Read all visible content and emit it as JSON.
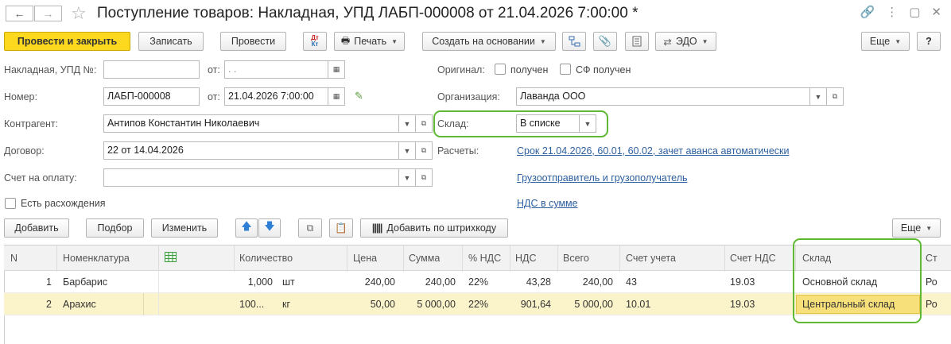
{
  "window": {
    "title": "Поступление товаров: Накладная, УПД ЛАБП-000008 от 21.04.2026 7:00:00 *"
  },
  "toolbar": {
    "post_close": "Провести и закрыть",
    "save": "Записать",
    "post": "Провести",
    "dt_kt_top": "Дт",
    "dt_kt_bottom": "Кт",
    "print": "Печать",
    "create_based": "Создать на основании",
    "edo": "ЭДО",
    "more": "Еще",
    "help": "?"
  },
  "form": {
    "invoice_label": "Накладная, УПД №:",
    "invoice_value": "",
    "from1_label": "от:",
    "from1_value": ".  .",
    "number_label": "Номер:",
    "number_value": "ЛАБП-000008",
    "from2_label": "от:",
    "from2_value": "21.04.2026  7:00:00",
    "counterparty_label": "Контрагент:",
    "counterparty_value": "Антипов Константин Николаевич",
    "contract_label": "Договор:",
    "contract_value": "22 от 14.04.2026",
    "payment_account_label": "Счет на оплату:",
    "payment_account_value": "",
    "discrepancies_label": "Есть расхождения",
    "original_label": "Оригинал:",
    "received_label": "получен",
    "sf_received_label": "СФ получен",
    "organization_label": "Организация:",
    "organization_value": "Лаванда ООО",
    "warehouse_label": "Склад:",
    "warehouse_value": "В списке",
    "settlements_label": "Расчеты:",
    "settlements_link": "Срок 21.04.2026, 60.01, 60.02, зачет аванса автоматически",
    "shipper_link": "Грузоотправитель и грузополучатель",
    "vat_link": "НДС в сумме"
  },
  "table_toolbar": {
    "add": "Добавить",
    "selection": "Подбор",
    "change": "Изменить",
    "barcode": "Добавить по штрихкоду",
    "more": "Еще"
  },
  "table": {
    "headers": {
      "n": "N",
      "item": "Номенклатура",
      "qty": "Количество",
      "price": "Цена",
      "sum": "Сумма",
      "vat_rate": "% НДС",
      "vat": "НДС",
      "total": "Всего",
      "account": "Счет учета",
      "vat_account": "Счет НДС",
      "warehouse": "Склад",
      "next": "Ст"
    },
    "rows": [
      {
        "n": "1",
        "item": "Барбарис",
        "qty": "1,000",
        "unit": "шт",
        "price": "240,00",
        "sum": "240,00",
        "vat_rate": "22%",
        "vat": "43,28",
        "total": "240,00",
        "account": "43",
        "vat_account": "19.03",
        "warehouse": "Основной склад",
        "next": "Ро"
      },
      {
        "n": "2",
        "item": "Арахис",
        "qty": "100...",
        "unit": "кг",
        "price": "50,00",
        "sum": "5 000,00",
        "vat_rate": "22%",
        "vat": "901,64",
        "total": "5 000,00",
        "account": "10.01",
        "vat_account": "19.03",
        "warehouse": "Центральный склад",
        "next": "Ро"
      }
    ]
  },
  "colors": {
    "primary_button": "#fcd91f",
    "link": "#2c5fa0",
    "highlight_frame": "#5fb834",
    "selected_row": "#fbf3c9"
  }
}
